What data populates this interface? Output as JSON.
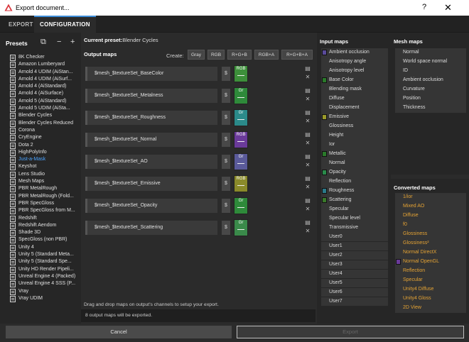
{
  "window": {
    "title": "Export document...",
    "help": "?",
    "close": "✕"
  },
  "tabs": [
    {
      "label": "EXPORT",
      "active": false
    },
    {
      "label": "CONFIGURATION",
      "active": true
    }
  ],
  "presets": {
    "header": "Presets",
    "icons": [
      "import-icon",
      "minus-icon",
      "plus-icon"
    ],
    "icon_glyphs": [
      "⧉",
      "−",
      "+"
    ],
    "selected_index": 14,
    "items": [
      "8K Checker",
      "Amazon Lumberyard",
      "Arnold 4  UDIM (AiStan...",
      "Arnold 4  UDIM (AiSurf...",
      "Arnold 4 (AiStandard)",
      "Arnold 4 (AiSurface)",
      "Arnold 5 (AiStandard)",
      "Arnold 5 UDIM (AiSta...",
      "Blender Cycles",
      "Blender Cycles Reduced",
      "Corona",
      "CryEngine",
      "Dota 2",
      "HighPolyInfo",
      "Just-a-Mask",
      "Keyshot",
      "Lens Studio",
      "Mesh Maps",
      "PBR MetalRough",
      "PBR MetalRough (Fold...",
      "PBR SpecGloss",
      "PBR SpecGloss from M...",
      "Redshift",
      "Redshift Aendom",
      "Shade 3D",
      "SpecGloss (non PBR)",
      "Unity 4",
      "Unity 5 (Standard Meta...",
      "Unity 5 (Standard Spe...",
      "Unity HD Render Pipeli...",
      "Unreal Engine 4 (Packed)",
      "Unreal Engine 4 SSS (P...",
      "Vray",
      "Vray UDIM"
    ]
  },
  "center": {
    "current_preset_label": "Current preset:",
    "current_preset_value": "Blender Cycles",
    "output_maps_label": "Output maps",
    "create_label": "Create:",
    "create_buttons": [
      "Gray",
      "RGB",
      "R+G+B",
      "RGB+A",
      "R+G+B+A"
    ],
    "output_maps": [
      {
        "name": "$mesh_$textureSet_BaseColor",
        "channel": "RGB",
        "color": "#3d8f3a"
      },
      {
        "name": "$mesh_$textureSet_Metalness",
        "channel": "Gr",
        "color": "#2e8a3a"
      },
      {
        "name": "$mesh_$textureSet_Roughness",
        "channel": "Gr",
        "color": "#2b8a8a"
      },
      {
        "name": "$mesh_$textureSet_Normal",
        "channel": "RGB",
        "color": "#6a3a9a"
      },
      {
        "name": "$mesh_$textureSet_AO",
        "channel": "Gr",
        "color": "#5a5a9a"
      },
      {
        "name": "$mesh_$textureSet_Emissive",
        "channel": "RGB",
        "color": "#8a8a2a"
      },
      {
        "name": "$mesh_$textureSet_Opacity",
        "channel": "Gr",
        "color": "#2e8a3a"
      },
      {
        "name": "$mesh_$textureSet_Scattering",
        "channel": "Gr",
        "color": "#3a8a4a"
      }
    ],
    "dollar_label": "$",
    "drag_note": "Drag and drop maps on output's channels to setup your export.",
    "status": "8 output maps will be exported."
  },
  "input_maps": {
    "header": "Input maps",
    "items": [
      {
        "label": "Ambient occlusion",
        "color": "#5a4a9a"
      },
      {
        "label": "Anisotropy angle",
        "color": ""
      },
      {
        "label": "Anisotropy level",
        "color": ""
      },
      {
        "label": "Base Color",
        "color": "#2a7a2a"
      },
      {
        "label": "Blending mask",
        "color": ""
      },
      {
        "label": "Diffuse",
        "color": ""
      },
      {
        "label": "Displacement",
        "color": ""
      },
      {
        "label": "Emissive",
        "color": "#9a9a2a"
      },
      {
        "label": "Glossiness",
        "color": ""
      },
      {
        "label": "Height",
        "color": ""
      },
      {
        "label": "Ior",
        "color": ""
      },
      {
        "label": "Metallic",
        "color": "#2a7a2a"
      },
      {
        "label": "Normal",
        "color": ""
      },
      {
        "label": "Opacity",
        "color": "#2a8a4a"
      },
      {
        "label": "Reflection",
        "color": ""
      },
      {
        "label": "Roughness",
        "color": "#2a7a8a"
      },
      {
        "label": "Scattering",
        "color": "#3a7a2a"
      },
      {
        "label": "Specular",
        "color": ""
      },
      {
        "label": "Specular level",
        "color": ""
      },
      {
        "label": "Transmissive",
        "color": ""
      },
      {
        "label": "User0",
        "color": ""
      },
      {
        "label": "User1",
        "color": ""
      },
      {
        "label": "User2",
        "color": ""
      },
      {
        "label": "User3",
        "color": ""
      },
      {
        "label": "User4",
        "color": ""
      },
      {
        "label": "User5",
        "color": ""
      },
      {
        "label": "User6",
        "color": ""
      },
      {
        "label": "User7",
        "color": ""
      }
    ]
  },
  "mesh_maps": {
    "header": "Mesh maps",
    "items": [
      "Normal",
      "World space normal",
      "ID",
      "Ambient occlusion",
      "Curvature",
      "Position",
      "Thickness"
    ]
  },
  "converted_maps": {
    "header": "Converted maps",
    "items": [
      {
        "label": "1/ior",
        "color": ""
      },
      {
        "label": "Mixed AO",
        "color": ""
      },
      {
        "label": "Diffuse",
        "color": ""
      },
      {
        "label": "f0",
        "color": ""
      },
      {
        "label": "Glossiness",
        "color": ""
      },
      {
        "label": "Glossiness²",
        "color": ""
      },
      {
        "label": "Normal DirectX",
        "color": ""
      },
      {
        "label": "Normal OpenGL",
        "color": "#6a3a9a"
      },
      {
        "label": "Reflection",
        "color": ""
      },
      {
        "label": "Specular",
        "color": ""
      },
      {
        "label": "Unity4 Diffuse",
        "color": ""
      },
      {
        "label": "Unity4 Gloss",
        "color": ""
      },
      {
        "label": "2D View",
        "color": ""
      }
    ]
  },
  "footer": {
    "cancel": "Cancel",
    "export": "Export"
  }
}
